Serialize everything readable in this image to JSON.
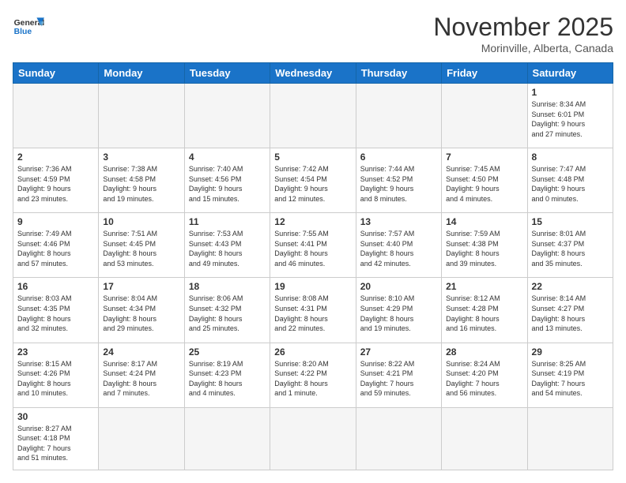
{
  "header": {
    "logo_general": "General",
    "logo_blue": "Blue",
    "title": "November 2025",
    "location": "Morinville, Alberta, Canada"
  },
  "days_of_week": [
    "Sunday",
    "Monday",
    "Tuesday",
    "Wednesday",
    "Thursday",
    "Friday",
    "Saturday"
  ],
  "weeks": [
    [
      {
        "day": "",
        "info": ""
      },
      {
        "day": "",
        "info": ""
      },
      {
        "day": "",
        "info": ""
      },
      {
        "day": "",
        "info": ""
      },
      {
        "day": "",
        "info": ""
      },
      {
        "day": "",
        "info": ""
      },
      {
        "day": "1",
        "info": "Sunrise: 8:34 AM\nSunset: 6:01 PM\nDaylight: 9 hours\nand 27 minutes."
      }
    ],
    [
      {
        "day": "2",
        "info": "Sunrise: 7:36 AM\nSunset: 4:59 PM\nDaylight: 9 hours\nand 23 minutes."
      },
      {
        "day": "3",
        "info": "Sunrise: 7:38 AM\nSunset: 4:58 PM\nDaylight: 9 hours\nand 19 minutes."
      },
      {
        "day": "4",
        "info": "Sunrise: 7:40 AM\nSunset: 4:56 PM\nDaylight: 9 hours\nand 15 minutes."
      },
      {
        "day": "5",
        "info": "Sunrise: 7:42 AM\nSunset: 4:54 PM\nDaylight: 9 hours\nand 12 minutes."
      },
      {
        "day": "6",
        "info": "Sunrise: 7:44 AM\nSunset: 4:52 PM\nDaylight: 9 hours\nand 8 minutes."
      },
      {
        "day": "7",
        "info": "Sunrise: 7:45 AM\nSunset: 4:50 PM\nDaylight: 9 hours\nand 4 minutes."
      },
      {
        "day": "8",
        "info": "Sunrise: 7:47 AM\nSunset: 4:48 PM\nDaylight: 9 hours\nand 0 minutes."
      }
    ],
    [
      {
        "day": "9",
        "info": "Sunrise: 7:49 AM\nSunset: 4:46 PM\nDaylight: 8 hours\nand 57 minutes."
      },
      {
        "day": "10",
        "info": "Sunrise: 7:51 AM\nSunset: 4:45 PM\nDaylight: 8 hours\nand 53 minutes."
      },
      {
        "day": "11",
        "info": "Sunrise: 7:53 AM\nSunset: 4:43 PM\nDaylight: 8 hours\nand 49 minutes."
      },
      {
        "day": "12",
        "info": "Sunrise: 7:55 AM\nSunset: 4:41 PM\nDaylight: 8 hours\nand 46 minutes."
      },
      {
        "day": "13",
        "info": "Sunrise: 7:57 AM\nSunset: 4:40 PM\nDaylight: 8 hours\nand 42 minutes."
      },
      {
        "day": "14",
        "info": "Sunrise: 7:59 AM\nSunset: 4:38 PM\nDaylight: 8 hours\nand 39 minutes."
      },
      {
        "day": "15",
        "info": "Sunrise: 8:01 AM\nSunset: 4:37 PM\nDaylight: 8 hours\nand 35 minutes."
      }
    ],
    [
      {
        "day": "16",
        "info": "Sunrise: 8:03 AM\nSunset: 4:35 PM\nDaylight: 8 hours\nand 32 minutes."
      },
      {
        "day": "17",
        "info": "Sunrise: 8:04 AM\nSunset: 4:34 PM\nDaylight: 8 hours\nand 29 minutes."
      },
      {
        "day": "18",
        "info": "Sunrise: 8:06 AM\nSunset: 4:32 PM\nDaylight: 8 hours\nand 25 minutes."
      },
      {
        "day": "19",
        "info": "Sunrise: 8:08 AM\nSunset: 4:31 PM\nDaylight: 8 hours\nand 22 minutes."
      },
      {
        "day": "20",
        "info": "Sunrise: 8:10 AM\nSunset: 4:29 PM\nDaylight: 8 hours\nand 19 minutes."
      },
      {
        "day": "21",
        "info": "Sunrise: 8:12 AM\nSunset: 4:28 PM\nDaylight: 8 hours\nand 16 minutes."
      },
      {
        "day": "22",
        "info": "Sunrise: 8:14 AM\nSunset: 4:27 PM\nDaylight: 8 hours\nand 13 minutes."
      }
    ],
    [
      {
        "day": "23",
        "info": "Sunrise: 8:15 AM\nSunset: 4:26 PM\nDaylight: 8 hours\nand 10 minutes."
      },
      {
        "day": "24",
        "info": "Sunrise: 8:17 AM\nSunset: 4:24 PM\nDaylight: 8 hours\nand 7 minutes."
      },
      {
        "day": "25",
        "info": "Sunrise: 8:19 AM\nSunset: 4:23 PM\nDaylight: 8 hours\nand 4 minutes."
      },
      {
        "day": "26",
        "info": "Sunrise: 8:20 AM\nSunset: 4:22 PM\nDaylight: 8 hours\nand 1 minute."
      },
      {
        "day": "27",
        "info": "Sunrise: 8:22 AM\nSunset: 4:21 PM\nDaylight: 7 hours\nand 59 minutes."
      },
      {
        "day": "28",
        "info": "Sunrise: 8:24 AM\nSunset: 4:20 PM\nDaylight: 7 hours\nand 56 minutes."
      },
      {
        "day": "29",
        "info": "Sunrise: 8:25 AM\nSunset: 4:19 PM\nDaylight: 7 hours\nand 54 minutes."
      }
    ],
    [
      {
        "day": "30",
        "info": "Sunrise: 8:27 AM\nSunset: 4:18 PM\nDaylight: 7 hours\nand 51 minutes."
      },
      {
        "day": "",
        "info": ""
      },
      {
        "day": "",
        "info": ""
      },
      {
        "day": "",
        "info": ""
      },
      {
        "day": "",
        "info": ""
      },
      {
        "day": "",
        "info": ""
      },
      {
        "day": "",
        "info": ""
      }
    ]
  ]
}
